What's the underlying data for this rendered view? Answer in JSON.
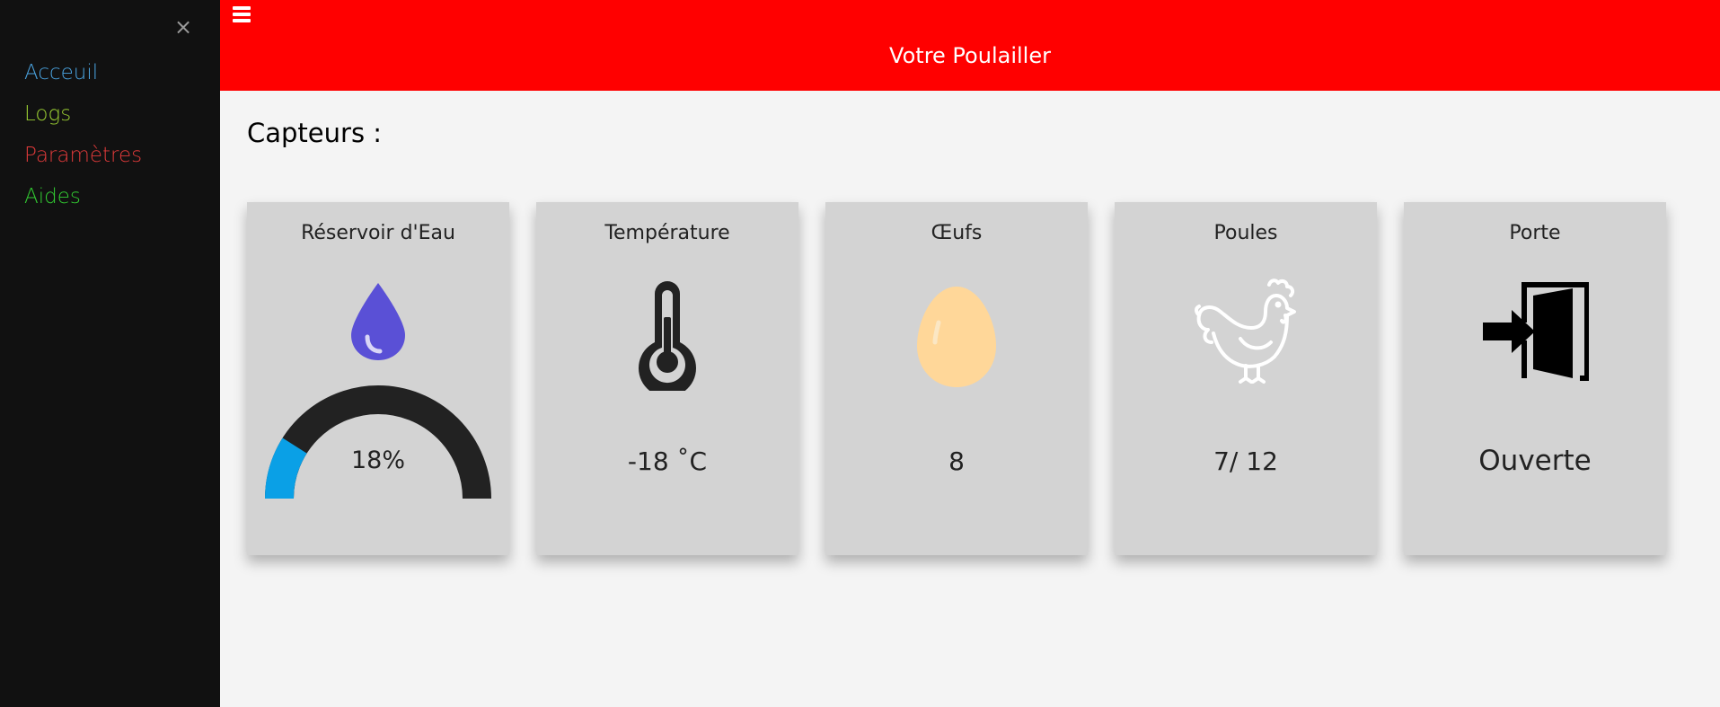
{
  "sidebar": {
    "close_label": "×",
    "items": [
      {
        "label": "Acceuil",
        "color": "#4aa3df"
      },
      {
        "label": "Logs",
        "color": "#9acd32"
      },
      {
        "label": "Paramètres",
        "color": "#e03a3a"
      },
      {
        "label": "Aides",
        "color": "#32cd32"
      }
    ]
  },
  "header": {
    "title": "Votre Poulailler",
    "background": "#ff0000",
    "menu_icon": "hamburger-icon"
  },
  "main": {
    "section_title": "Capteurs :"
  },
  "cards": [
    {
      "title": "Réservoir d'Eau",
      "icon": "water-drop-icon",
      "value": "18%",
      "level_percent": 18,
      "icon_color": "#5a50d6",
      "gauge_fill_color": "#0aa0e6"
    },
    {
      "title": "Température",
      "icon": "thermometer-icon",
      "value": "-18 ˚C"
    },
    {
      "title": "Œufs",
      "icon": "egg-icon",
      "value": "8",
      "icon_color": "#ffd799"
    },
    {
      "title": "Poules",
      "icon": "chicken-icon",
      "value": "7/ 12"
    },
    {
      "title": "Porte",
      "icon": "door-enter-icon",
      "value": "Ouverte"
    }
  ]
}
